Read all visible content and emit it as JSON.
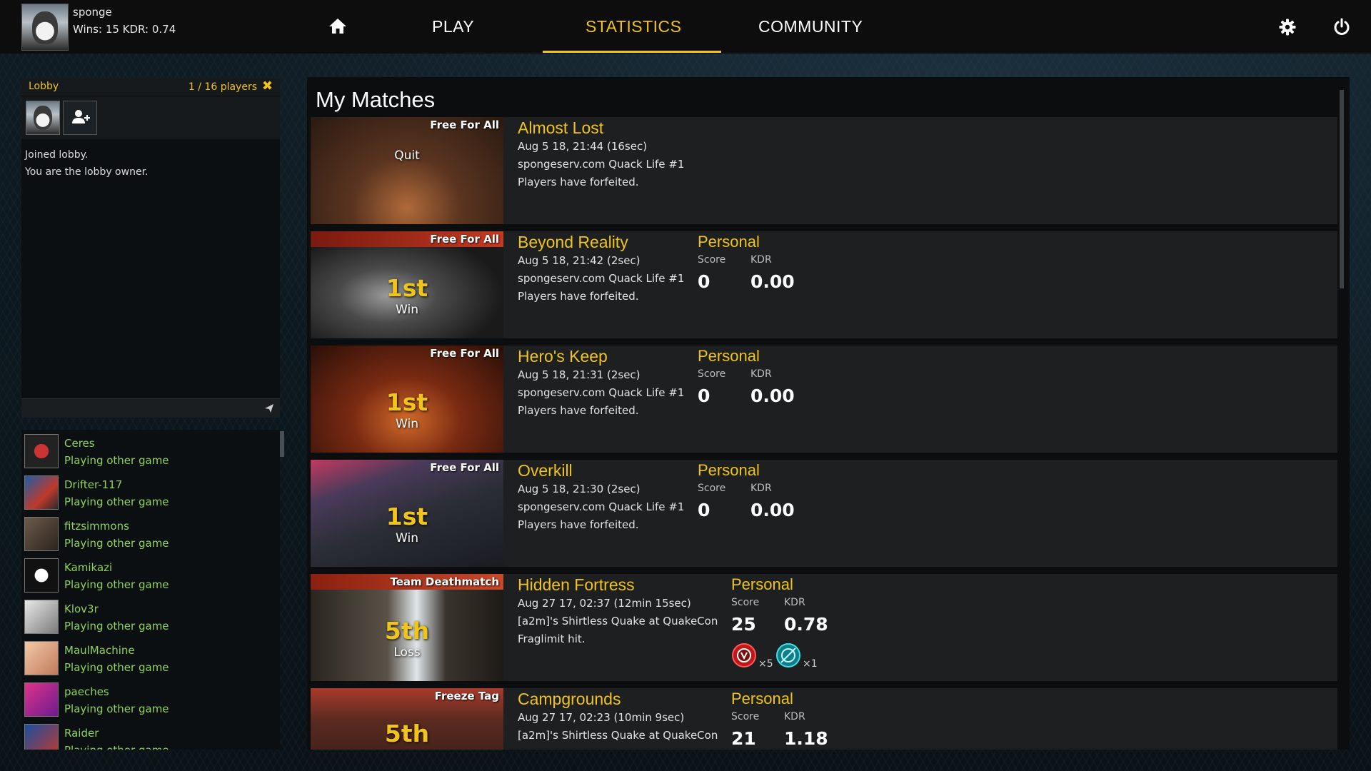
{
  "user": {
    "name": "sponge",
    "stats": "Wins: 15 KDR: 0.74"
  },
  "nav": {
    "play": "PLAY",
    "statistics": "STATISTICS",
    "community": "COMMUNITY"
  },
  "lobby": {
    "title": "Lobby",
    "count": "1 / 16 players",
    "log": [
      "Joined lobby.",
      "You are the lobby owner."
    ]
  },
  "friends": [
    {
      "name": "Ceres",
      "status": "Playing other game"
    },
    {
      "name": "Drifter-117",
      "status": "Playing other game"
    },
    {
      "name": "fitzsimmons",
      "status": "Playing other game"
    },
    {
      "name": "Kamikazi",
      "status": "Playing other game"
    },
    {
      "name": "Klov3r",
      "status": "Playing other game"
    },
    {
      "name": "MaulMachine",
      "status": "Playing other game"
    },
    {
      "name": "paeches",
      "status": "Playing other game"
    },
    {
      "name": "Raider",
      "status": "Playing other game"
    }
  ],
  "main": {
    "title": "My Matches",
    "personal_label": "Personal",
    "score_label": "Score",
    "kdr_label": "KDR"
  },
  "matches": [
    {
      "mode": "Free For All",
      "result": "",
      "outcome": "Quit",
      "name": "Almost Lost",
      "date": "Aug 5 18, 21:44 (16sec)",
      "server": "spongeserv.com Quack Life #1",
      "note": "Players have forfeited.",
      "score": "",
      "kdr": "",
      "medals": []
    },
    {
      "mode": "Free For All",
      "result": "1st",
      "outcome": "Win",
      "name": "Beyond Reality",
      "date": "Aug 5 18, 21:42 (2sec)",
      "server": "spongeserv.com Quack Life #1",
      "note": "Players have forfeited.",
      "score": "0",
      "kdr": "0.00",
      "medals": []
    },
    {
      "mode": "Free For All",
      "result": "1st",
      "outcome": "Win",
      "name": "Hero's Keep",
      "date": "Aug 5 18, 21:31 (2sec)",
      "server": "spongeserv.com Quack Life #1",
      "note": "Players have forfeited.",
      "score": "0",
      "kdr": "0.00",
      "medals": []
    },
    {
      "mode": "Free For All",
      "result": "1st",
      "outcome": "Win",
      "name": "Overkill",
      "date": "Aug 5 18, 21:30 (2sec)",
      "server": "spongeserv.com Quack Life #1",
      "note": "Players have forfeited.",
      "score": "0",
      "kdr": "0.00",
      "medals": []
    },
    {
      "mode": "Team Deathmatch",
      "result": "5th",
      "outcome": "Loss",
      "name": "Hidden Fortress",
      "date": "Aug 27 17, 02:37 (12min 15sec)",
      "server": "[a2m]'s Shirtless Quake at QuakeCon",
      "note": "Fraglimit hit.",
      "score": "25",
      "kdr": "0.78",
      "medals": [
        {
          "icon": "excellent-medal-icon",
          "count": "×5"
        },
        {
          "icon": "accuracy-medal-icon",
          "count": "×1"
        }
      ]
    },
    {
      "mode": "Freeze Tag",
      "result": "5th",
      "outcome": "",
      "name": "Campgrounds",
      "date": "Aug 27 17, 02:23 (10min 9sec)",
      "server": "[a2m]'s Shirtless Quake at QuakeCon",
      "note": "",
      "score": "21",
      "kdr": "1.18",
      "medals": []
    }
  ],
  "colors": {
    "accent": "#f0c419",
    "friend": "#8ed35a",
    "panel": "#1d1f21"
  }
}
